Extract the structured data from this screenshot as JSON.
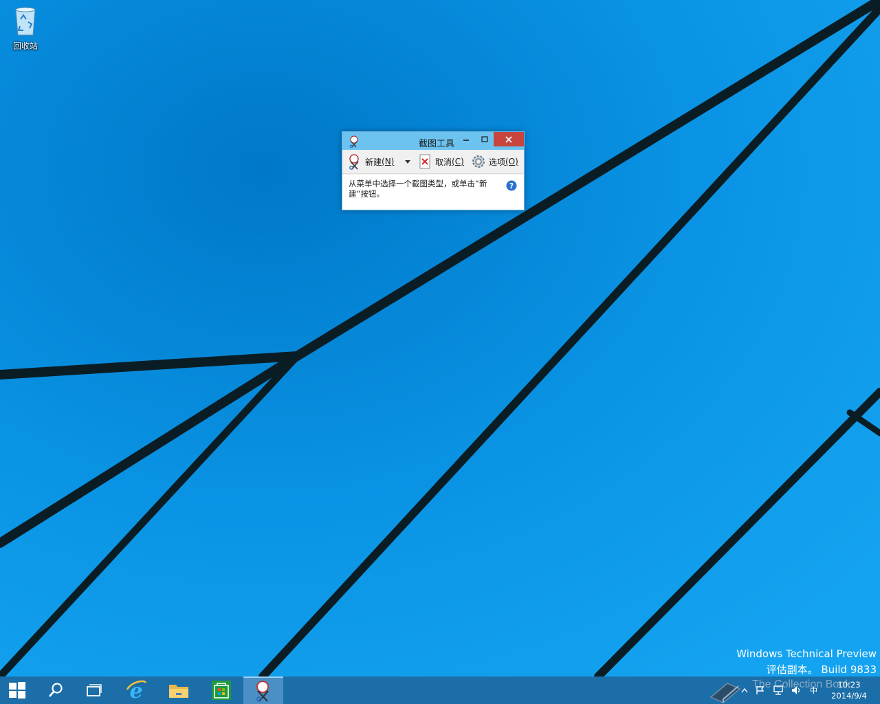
{
  "desktop": {
    "icons": [
      {
        "label": "回收站",
        "icon": "recycle-bin-icon"
      }
    ],
    "watermark": {
      "line1": "Windows Technical Preview",
      "line2": "评估副本。 Build 9833"
    }
  },
  "snipping_tool": {
    "title": "截图工具",
    "toolbar": {
      "new_label": "新建",
      "new_accel": "(N)",
      "cancel_label": "取消",
      "cancel_accel": "(C)",
      "options_label": "选项",
      "options_accel": "(O)"
    },
    "message": "从菜单中选择一个截图类型，或单击“新建”按钮。"
  },
  "taskbar": {
    "items": [
      {
        "name": "start",
        "icon": "windows-logo-icon"
      },
      {
        "name": "search",
        "icon": "search-icon"
      },
      {
        "name": "task-view",
        "icon": "task-view-icon"
      },
      {
        "name": "internet-explorer",
        "icon": "ie-icon"
      },
      {
        "name": "file-explorer",
        "icon": "folder-icon"
      },
      {
        "name": "store",
        "icon": "store-icon"
      },
      {
        "name": "snipping-tool",
        "icon": "scissors-icon",
        "active": true
      }
    ],
    "tray": {
      "ime": "中",
      "overlay_text": "The Collection Book"
    },
    "clock": {
      "time": "10:23",
      "date": "2014/9/4"
    }
  },
  "colors": {
    "wallpaper": "#0a8fe0",
    "taskbar": "#1c6ea8",
    "titlebar": "#6cc3f0",
    "close_button": "#c7453d"
  }
}
